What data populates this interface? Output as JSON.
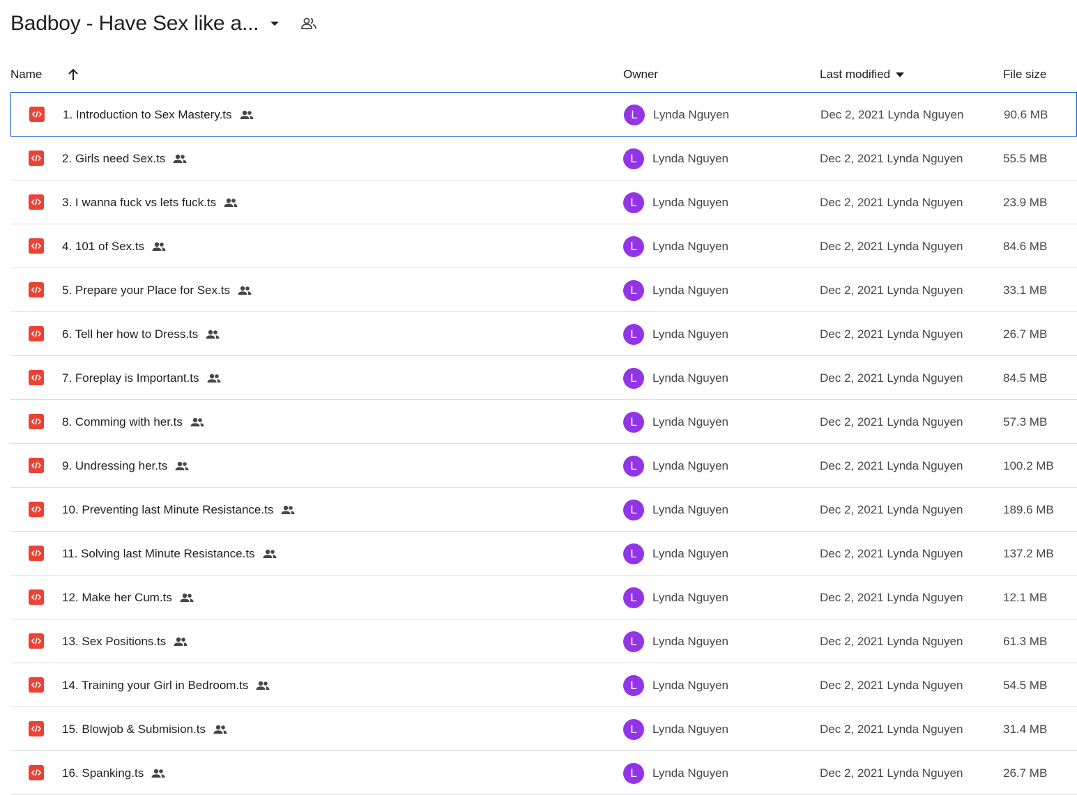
{
  "folder": {
    "title": "Badboy - Have Sex like a...",
    "dropdown_icon": "arrow-drop-down-icon",
    "shared_icon": "shared-folder-icon"
  },
  "columns": {
    "name": "Name",
    "sort_icon": "arrow-up-icon",
    "owner": "Owner",
    "last_modified": "Last modified",
    "modified_sort_icon": "arrow-drop-down-icon",
    "file_size": "File size"
  },
  "colors": {
    "file_icon": "#ea4335",
    "avatar": "#9334e6",
    "selection_border": "#0b57d0"
  },
  "files": [
    {
      "name": "1. Introduction to Sex Mastery.ts",
      "owner_initial": "L",
      "owner": "Lynda Nguyen",
      "modified": "Dec 2, 2021 Lynda Nguyen",
      "size": "90.6 MB",
      "selected": true
    },
    {
      "name": "2. Girls need Sex.ts",
      "owner_initial": "L",
      "owner": "Lynda Nguyen",
      "modified": "Dec 2, 2021 Lynda Nguyen",
      "size": "55.5 MB"
    },
    {
      "name": "3. I wanna fuck vs lets fuck.ts",
      "owner_initial": "L",
      "owner": "Lynda Nguyen",
      "modified": "Dec 2, 2021 Lynda Nguyen",
      "size": "23.9 MB"
    },
    {
      "name": "4. 101 of Sex.ts",
      "owner_initial": "L",
      "owner": "Lynda Nguyen",
      "modified": "Dec 2, 2021 Lynda Nguyen",
      "size": "84.6 MB"
    },
    {
      "name": "5. Prepare your Place for Sex.ts",
      "owner_initial": "L",
      "owner": "Lynda Nguyen",
      "modified": "Dec 2, 2021 Lynda Nguyen",
      "size": "33.1 MB"
    },
    {
      "name": "6. Tell her how to Dress.ts",
      "owner_initial": "L",
      "owner": "Lynda Nguyen",
      "modified": "Dec 2, 2021 Lynda Nguyen",
      "size": "26.7 MB"
    },
    {
      "name": "7. Foreplay is Important.ts",
      "owner_initial": "L",
      "owner": "Lynda Nguyen",
      "modified": "Dec 2, 2021 Lynda Nguyen",
      "size": "84.5 MB"
    },
    {
      "name": "8. Comming with her.ts",
      "owner_initial": "L",
      "owner": "Lynda Nguyen",
      "modified": "Dec 2, 2021 Lynda Nguyen",
      "size": "57.3 MB"
    },
    {
      "name": "9. Undressing her.ts",
      "owner_initial": "L",
      "owner": "Lynda Nguyen",
      "modified": "Dec 2, 2021 Lynda Nguyen",
      "size": "100.2 MB"
    },
    {
      "name": "10. Preventing last Minute Resistance.ts",
      "owner_initial": "L",
      "owner": "Lynda Nguyen",
      "modified": "Dec 2, 2021 Lynda Nguyen",
      "size": "189.6 MB"
    },
    {
      "name": "11. Solving last Minute Resistance.ts",
      "owner_initial": "L",
      "owner": "Lynda Nguyen",
      "modified": "Dec 2, 2021 Lynda Nguyen",
      "size": "137.2 MB"
    },
    {
      "name": "12. Make her Cum.ts",
      "owner_initial": "L",
      "owner": "Lynda Nguyen",
      "modified": "Dec 2, 2021 Lynda Nguyen",
      "size": "12.1 MB"
    },
    {
      "name": "13. Sex Positions.ts",
      "owner_initial": "L",
      "owner": "Lynda Nguyen",
      "modified": "Dec 2, 2021 Lynda Nguyen",
      "size": "61.3 MB"
    },
    {
      "name": "14. Training your Girl in Bedroom.ts",
      "owner_initial": "L",
      "owner": "Lynda Nguyen",
      "modified": "Dec 2, 2021 Lynda Nguyen",
      "size": "54.5 MB"
    },
    {
      "name": "15. Blowjob & Submision.ts",
      "owner_initial": "L",
      "owner": "Lynda Nguyen",
      "modified": "Dec 2, 2021 Lynda Nguyen",
      "size": "31.4 MB"
    },
    {
      "name": "16. Spanking.ts",
      "owner_initial": "L",
      "owner": "Lynda Nguyen",
      "modified": "Dec 2, 2021 Lynda Nguyen",
      "size": "26.7 MB"
    }
  ]
}
